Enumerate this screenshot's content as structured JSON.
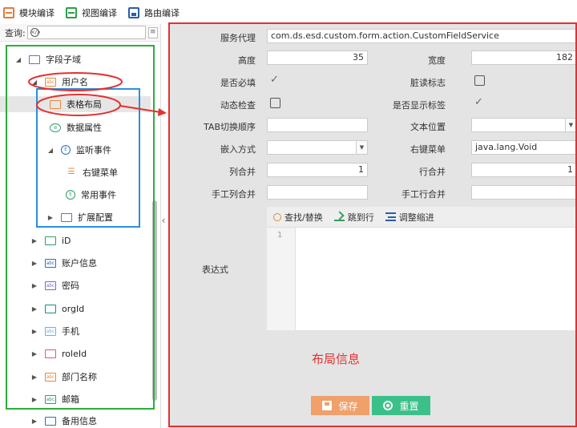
{
  "toolbar": {
    "items": [
      {
        "label": "模块编译",
        "icon": "module-compile-icon"
      },
      {
        "label": "视图编译",
        "icon": "view-compile-icon"
      },
      {
        "label": "路由编译",
        "icon": "route-compile-icon"
      }
    ]
  },
  "search": {
    "label": "查询:",
    "value": ""
  },
  "tree": {
    "root_label": "字段子域",
    "user_name": "用户名",
    "table_layout": "表格布局",
    "data_props": "数据属性",
    "listen_events": "监听事件",
    "context_menu": "右键菜单",
    "common_events": "常用事件",
    "extension": "扩展配置",
    "items": [
      {
        "label": "iD"
      },
      {
        "label": "账户信息"
      },
      {
        "label": "密码"
      },
      {
        "label": "orgId"
      },
      {
        "label": "手机"
      },
      {
        "label": "roleId"
      },
      {
        "label": "部门名称"
      },
      {
        "label": "邮箱"
      },
      {
        "label": "备用信息"
      }
    ]
  },
  "form": {
    "service_proxy_label": "服务代理",
    "service_proxy_value": "com.ds.esd.custom.form.action.CustomFieldService",
    "height_label": "高度",
    "height_value": "35",
    "width_label": "宽度",
    "width_value": "182",
    "required_label": "是否必填",
    "dirty_label": "脏读标志",
    "dynamic_check_label": "动态检查",
    "show_label_label": "是否显示标签",
    "tab_order_label": "TAB切换顺序",
    "tab_order_value": "",
    "text_pos_label": "文本位置",
    "text_pos_value": "",
    "embed_label": "嵌入方式",
    "embed_value": "",
    "context_menu_label": "右键菜单",
    "context_menu_value": "java.lang.Void",
    "col_merge_label": "列合并",
    "col_merge_value": "1",
    "row_merge_label": "行合并",
    "row_merge_value": "1",
    "manual_col_merge_label": "手工列合并",
    "manual_col_merge_value": "",
    "manual_row_merge_label": "手工行合并",
    "manual_row_merge_value": "",
    "expression_label": "表达式",
    "required_checked": true,
    "dirty_checked": false,
    "dynamic_check_checked": false,
    "show_label_checked": true
  },
  "editor": {
    "find_label": "查找/替换",
    "goto_label": "跳到行",
    "indent_label": "调整缩进",
    "line_number": "1",
    "content": ""
  },
  "annotation": {
    "layout_info": "布局信息"
  },
  "buttons": {
    "save": "保存",
    "reset": "重置"
  },
  "colors": {
    "annotation_red": "#e53030",
    "annotation_green": "#2cae3c",
    "annotation_blue": "#2a8fdc",
    "save_button": "#f0a06a",
    "reset_button": "#3cc08a"
  }
}
